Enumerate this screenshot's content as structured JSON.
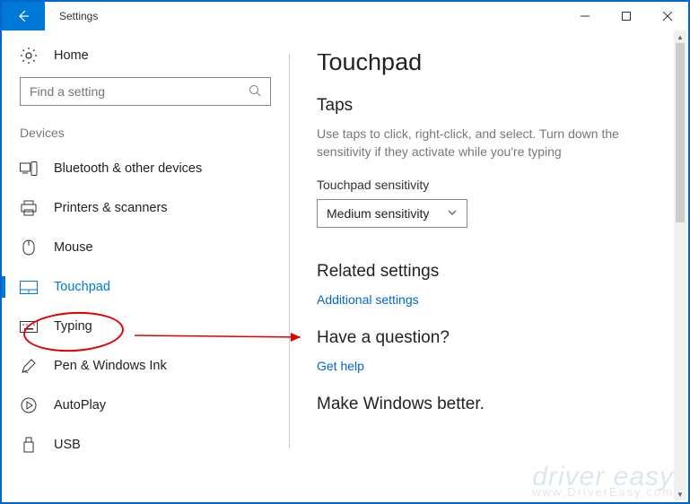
{
  "window": {
    "title": "Settings"
  },
  "sidebar": {
    "home": "Home",
    "search_placeholder": "Find a setting",
    "section": "Devices",
    "items": [
      {
        "label": "Bluetooth & other devices"
      },
      {
        "label": "Printers & scanners"
      },
      {
        "label": "Mouse"
      },
      {
        "label": "Touchpad"
      },
      {
        "label": "Typing"
      },
      {
        "label": "Pen & Windows Ink"
      },
      {
        "label": "AutoPlay"
      },
      {
        "label": "USB"
      }
    ]
  },
  "main": {
    "title": "Touchpad",
    "taps_heading": "Taps",
    "taps_desc": "Use taps to click, right-click, and select. Turn down the sensitivity if they activate while you're typing",
    "sensitivity_label": "Touchpad sensitivity",
    "sensitivity_value": "Medium sensitivity",
    "related_heading": "Related settings",
    "related_link": "Additional settings",
    "question_heading": "Have a question?",
    "help_link": "Get help",
    "better_heading": "Make Windows better."
  },
  "watermark": {
    "main": "driver easy",
    "sub": "www.DriverEasy.com"
  }
}
